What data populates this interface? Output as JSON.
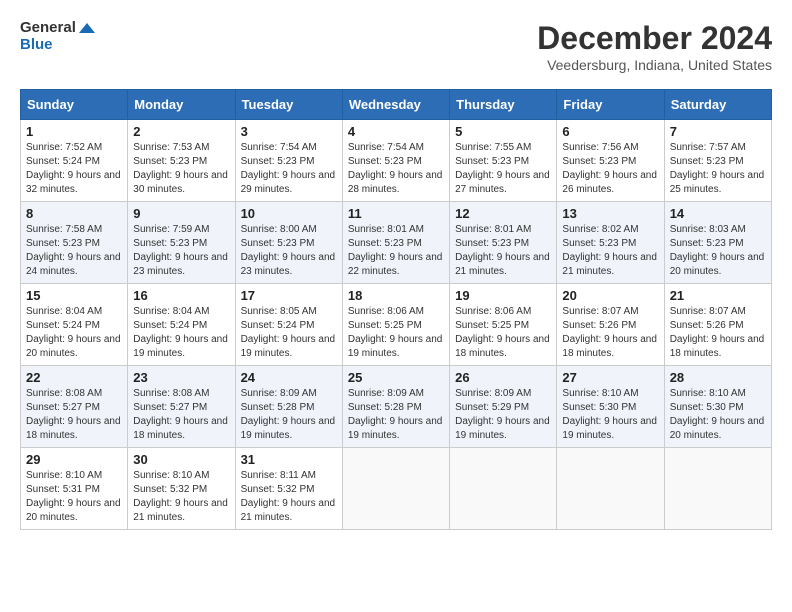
{
  "header": {
    "logo_line1": "General",
    "logo_line2": "Blue",
    "title": "December 2024",
    "subtitle": "Veedersburg, Indiana, United States"
  },
  "calendar": {
    "headers": [
      "Sunday",
      "Monday",
      "Tuesday",
      "Wednesday",
      "Thursday",
      "Friday",
      "Saturday"
    ],
    "weeks": [
      [
        {
          "day": "1",
          "info": "Sunrise: 7:52 AM\nSunset: 5:24 PM\nDaylight: 9 hours and 32 minutes."
        },
        {
          "day": "2",
          "info": "Sunrise: 7:53 AM\nSunset: 5:23 PM\nDaylight: 9 hours and 30 minutes."
        },
        {
          "day": "3",
          "info": "Sunrise: 7:54 AM\nSunset: 5:23 PM\nDaylight: 9 hours and 29 minutes."
        },
        {
          "day": "4",
          "info": "Sunrise: 7:54 AM\nSunset: 5:23 PM\nDaylight: 9 hours and 28 minutes."
        },
        {
          "day": "5",
          "info": "Sunrise: 7:55 AM\nSunset: 5:23 PM\nDaylight: 9 hours and 27 minutes."
        },
        {
          "day": "6",
          "info": "Sunrise: 7:56 AM\nSunset: 5:23 PM\nDaylight: 9 hours and 26 minutes."
        },
        {
          "day": "7",
          "info": "Sunrise: 7:57 AM\nSunset: 5:23 PM\nDaylight: 9 hours and 25 minutes."
        }
      ],
      [
        {
          "day": "8",
          "info": "Sunrise: 7:58 AM\nSunset: 5:23 PM\nDaylight: 9 hours and 24 minutes."
        },
        {
          "day": "9",
          "info": "Sunrise: 7:59 AM\nSunset: 5:23 PM\nDaylight: 9 hours and 23 minutes."
        },
        {
          "day": "10",
          "info": "Sunrise: 8:00 AM\nSunset: 5:23 PM\nDaylight: 9 hours and 23 minutes."
        },
        {
          "day": "11",
          "info": "Sunrise: 8:01 AM\nSunset: 5:23 PM\nDaylight: 9 hours and 22 minutes."
        },
        {
          "day": "12",
          "info": "Sunrise: 8:01 AM\nSunset: 5:23 PM\nDaylight: 9 hours and 21 minutes."
        },
        {
          "day": "13",
          "info": "Sunrise: 8:02 AM\nSunset: 5:23 PM\nDaylight: 9 hours and 21 minutes."
        },
        {
          "day": "14",
          "info": "Sunrise: 8:03 AM\nSunset: 5:23 PM\nDaylight: 9 hours and 20 minutes."
        }
      ],
      [
        {
          "day": "15",
          "info": "Sunrise: 8:04 AM\nSunset: 5:24 PM\nDaylight: 9 hours and 20 minutes."
        },
        {
          "day": "16",
          "info": "Sunrise: 8:04 AM\nSunset: 5:24 PM\nDaylight: 9 hours and 19 minutes."
        },
        {
          "day": "17",
          "info": "Sunrise: 8:05 AM\nSunset: 5:24 PM\nDaylight: 9 hours and 19 minutes."
        },
        {
          "day": "18",
          "info": "Sunrise: 8:06 AM\nSunset: 5:25 PM\nDaylight: 9 hours and 19 minutes."
        },
        {
          "day": "19",
          "info": "Sunrise: 8:06 AM\nSunset: 5:25 PM\nDaylight: 9 hours and 18 minutes."
        },
        {
          "day": "20",
          "info": "Sunrise: 8:07 AM\nSunset: 5:26 PM\nDaylight: 9 hours and 18 minutes."
        },
        {
          "day": "21",
          "info": "Sunrise: 8:07 AM\nSunset: 5:26 PM\nDaylight: 9 hours and 18 minutes."
        }
      ],
      [
        {
          "day": "22",
          "info": "Sunrise: 8:08 AM\nSunset: 5:27 PM\nDaylight: 9 hours and 18 minutes."
        },
        {
          "day": "23",
          "info": "Sunrise: 8:08 AM\nSunset: 5:27 PM\nDaylight: 9 hours and 18 minutes."
        },
        {
          "day": "24",
          "info": "Sunrise: 8:09 AM\nSunset: 5:28 PM\nDaylight: 9 hours and 19 minutes."
        },
        {
          "day": "25",
          "info": "Sunrise: 8:09 AM\nSunset: 5:28 PM\nDaylight: 9 hours and 19 minutes."
        },
        {
          "day": "26",
          "info": "Sunrise: 8:09 AM\nSunset: 5:29 PM\nDaylight: 9 hours and 19 minutes."
        },
        {
          "day": "27",
          "info": "Sunrise: 8:10 AM\nSunset: 5:30 PM\nDaylight: 9 hours and 19 minutes."
        },
        {
          "day": "28",
          "info": "Sunrise: 8:10 AM\nSunset: 5:30 PM\nDaylight: 9 hours and 20 minutes."
        }
      ],
      [
        {
          "day": "29",
          "info": "Sunrise: 8:10 AM\nSunset: 5:31 PM\nDaylight: 9 hours and 20 minutes."
        },
        {
          "day": "30",
          "info": "Sunrise: 8:10 AM\nSunset: 5:32 PM\nDaylight: 9 hours and 21 minutes."
        },
        {
          "day": "31",
          "info": "Sunrise: 8:11 AM\nSunset: 5:32 PM\nDaylight: 9 hours and 21 minutes."
        },
        {
          "day": "",
          "info": ""
        },
        {
          "day": "",
          "info": ""
        },
        {
          "day": "",
          "info": ""
        },
        {
          "day": "",
          "info": ""
        }
      ]
    ]
  }
}
